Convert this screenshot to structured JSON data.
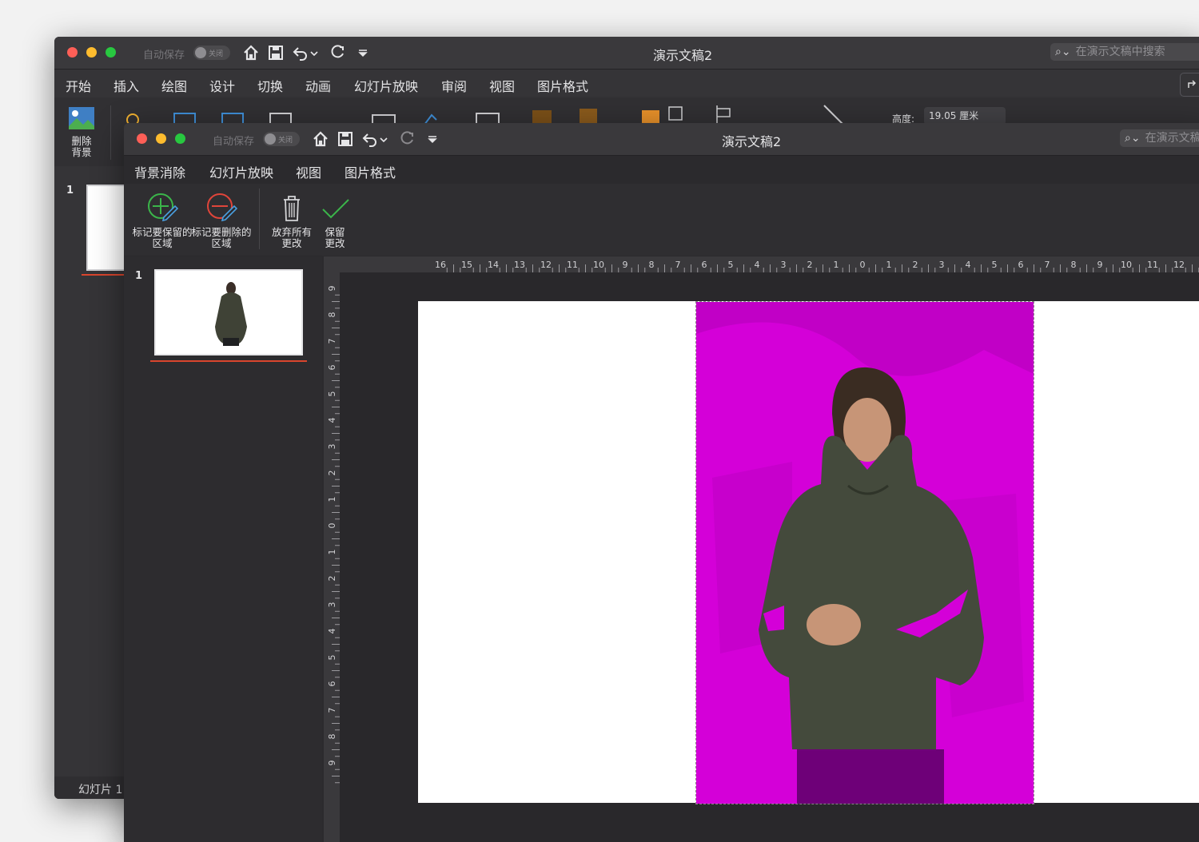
{
  "back_window": {
    "autosave_label": "自动保存",
    "toggle_label": "关闭",
    "title": "演示文稿2",
    "search_placeholder": "在演示文稿中搜索",
    "tabs": [
      "开始",
      "插入",
      "绘图",
      "设计",
      "切换",
      "动画",
      "幻灯片放映",
      "审阅",
      "视图",
      "图片格式"
    ],
    "active_tab": "图片格式",
    "remove_bg_label": "删除背景",
    "height_label": "高度:",
    "height_value": "19.05 厘米",
    "slide_number": "1",
    "status_text": "幻灯片 1"
  },
  "front_window": {
    "autosave_label": "自动保存",
    "toggle_label": "关闭",
    "title": "演示文稿2",
    "search_placeholder": "在演示文稿中搜索",
    "tabs": [
      "背景消除",
      "幻灯片放映",
      "视图",
      "图片格式"
    ],
    "active_tab": "背景消除",
    "ribbon": {
      "mark_keep": "标记要保留的区域",
      "mark_remove": "标记要删除的区域",
      "discard": "放弃所有更改",
      "keep": "保留更改"
    },
    "slide_number": "1",
    "ruler_h": [
      "16",
      "15",
      "14",
      "13",
      "12",
      "11",
      "10",
      "9",
      "8",
      "7",
      "6",
      "5",
      "4",
      "3",
      "2",
      "1",
      "0",
      "1",
      "2",
      "3",
      "4",
      "5",
      "6",
      "7",
      "8",
      "9",
      "10",
      "11",
      "12"
    ],
    "ruler_v": [
      "9",
      "8",
      "7",
      "6",
      "5",
      "4",
      "3",
      "2",
      "1",
      "0",
      "1",
      "2",
      "3",
      "4",
      "5",
      "6",
      "7",
      "8",
      "9"
    ]
  },
  "colors": {
    "removal_overlay": "#d400d8",
    "accent_underline": "#d9452d",
    "add_green": "#3bb54a",
    "remove_red": "#e0453a"
  }
}
